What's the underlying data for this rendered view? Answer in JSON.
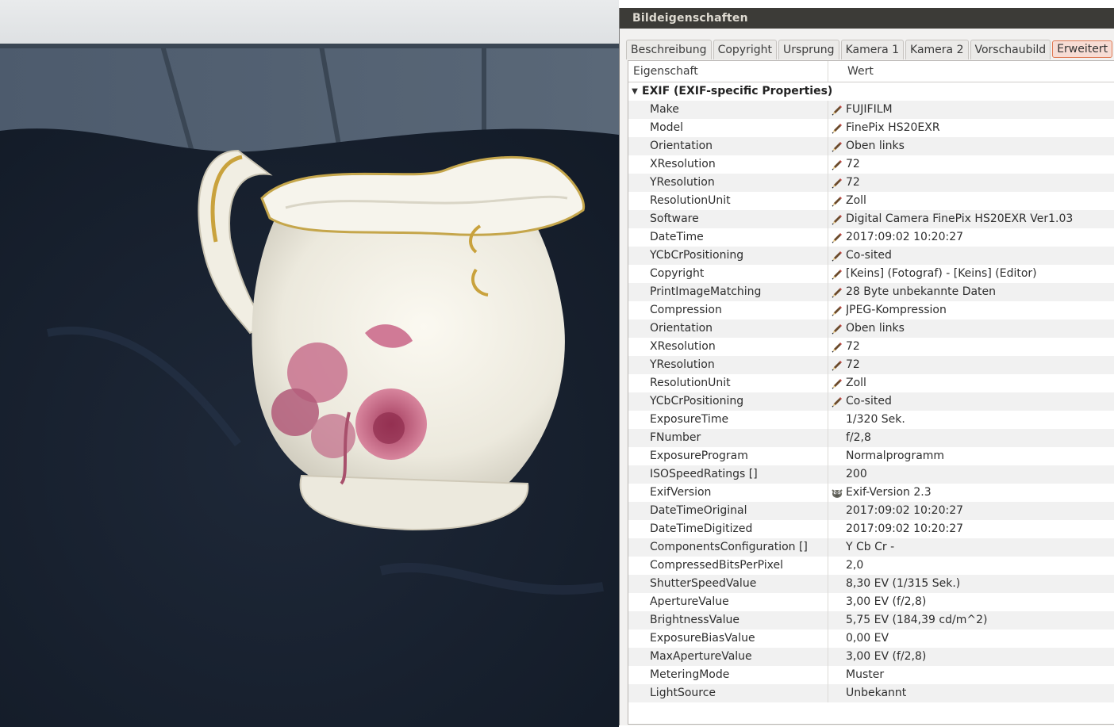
{
  "window": {
    "title": "Bildeigenschaften"
  },
  "tabs": [
    {
      "label": "Beschreibung",
      "active": false
    },
    {
      "label": "Copyright",
      "active": false
    },
    {
      "label": "Ursprung",
      "active": false
    },
    {
      "label": "Kamera 1",
      "active": false
    },
    {
      "label": "Kamera 2",
      "active": false
    },
    {
      "label": "Vorschaubild",
      "active": false
    },
    {
      "label": "Erweitert",
      "active": true
    }
  ],
  "columns": {
    "name": "Eigenschaft",
    "value": "Wert"
  },
  "group": {
    "label": "EXIF (EXIF-specific Properties)",
    "expanded": true
  },
  "rows": [
    {
      "name": "Make",
      "value": "FUJIFILM",
      "icon": "pencil-icon"
    },
    {
      "name": "Model",
      "value": "FinePix HS20EXR",
      "icon": "pencil-icon"
    },
    {
      "name": "Orientation",
      "value": "Oben links",
      "icon": "pencil-icon"
    },
    {
      "name": "XResolution",
      "value": "72",
      "icon": "pencil-icon"
    },
    {
      "name": "YResolution",
      "value": "72",
      "icon": "pencil-icon"
    },
    {
      "name": "ResolutionUnit",
      "value": "Zoll",
      "icon": "pencil-icon"
    },
    {
      "name": "Software",
      "value": "Digital Camera FinePix HS20EXR Ver1.03",
      "icon": "pencil-icon"
    },
    {
      "name": "DateTime",
      "value": "2017:09:02 10:20:27",
      "icon": "pencil-icon"
    },
    {
      "name": "YCbCrPositioning",
      "value": "Co-sited",
      "icon": "pencil-icon"
    },
    {
      "name": "Copyright",
      "value": "[Keins] (Fotograf) - [Keins] (Editor)",
      "icon": "pencil-icon"
    },
    {
      "name": "PrintImageMatching",
      "value": "28 Byte unbekannte Daten",
      "icon": "pencil-icon"
    },
    {
      "name": "Compression",
      "value": "JPEG-Kompression",
      "icon": "pencil-icon"
    },
    {
      "name": "Orientation",
      "value": "Oben links",
      "icon": "pencil-icon"
    },
    {
      "name": "XResolution",
      "value": "72",
      "icon": "pencil-icon"
    },
    {
      "name": "YResolution",
      "value": "72",
      "icon": "pencil-icon"
    },
    {
      "name": "ResolutionUnit",
      "value": "Zoll",
      "icon": "pencil-icon"
    },
    {
      "name": "YCbCrPositioning",
      "value": "Co-sited",
      "icon": "pencil-icon"
    },
    {
      "name": "ExposureTime",
      "value": "1/320 Sek.",
      "icon": ""
    },
    {
      "name": "FNumber",
      "value": "f/2,8",
      "icon": ""
    },
    {
      "name": "ExposureProgram",
      "value": "Normalprogramm",
      "icon": ""
    },
    {
      "name": "ISOSpeedRatings []",
      "value": "200",
      "icon": ""
    },
    {
      "name": "ExifVersion",
      "value": "Exif-Version 2.3",
      "icon": "wilber-icon"
    },
    {
      "name": "DateTimeOriginal",
      "value": "2017:09:02 10:20:27",
      "icon": ""
    },
    {
      "name": "DateTimeDigitized",
      "value": "2017:09:02 10:20:27",
      "icon": ""
    },
    {
      "name": "ComponentsConfiguration []",
      "value": "Y Cb Cr -",
      "icon": ""
    },
    {
      "name": "CompressedBitsPerPixel",
      "value": "2,0",
      "icon": ""
    },
    {
      "name": "ShutterSpeedValue",
      "value": "8,30 EV (1/315 Sek.)",
      "icon": ""
    },
    {
      "name": "ApertureValue",
      "value": "3,00 EV (f/2,8)",
      "icon": ""
    },
    {
      "name": "BrightnessValue",
      "value": "5,75 EV (184,39 cd/m^2)",
      "icon": ""
    },
    {
      "name": "ExposureBiasValue",
      "value": "0,00 EV",
      "icon": ""
    },
    {
      "name": "MaxApertureValue",
      "value": "3,00 EV (f/2,8)",
      "icon": ""
    },
    {
      "name": "MeteringMode",
      "value": "Muster",
      "icon": ""
    },
    {
      "name": "LightSource",
      "value": "Unbekannt",
      "icon": ""
    }
  ],
  "colors": {
    "titlebar": "#3c3b37",
    "active_tab_border": "#e07a55",
    "active_tab_bg": "#f7dcd4",
    "row_alt": "#f1f1f1"
  }
}
